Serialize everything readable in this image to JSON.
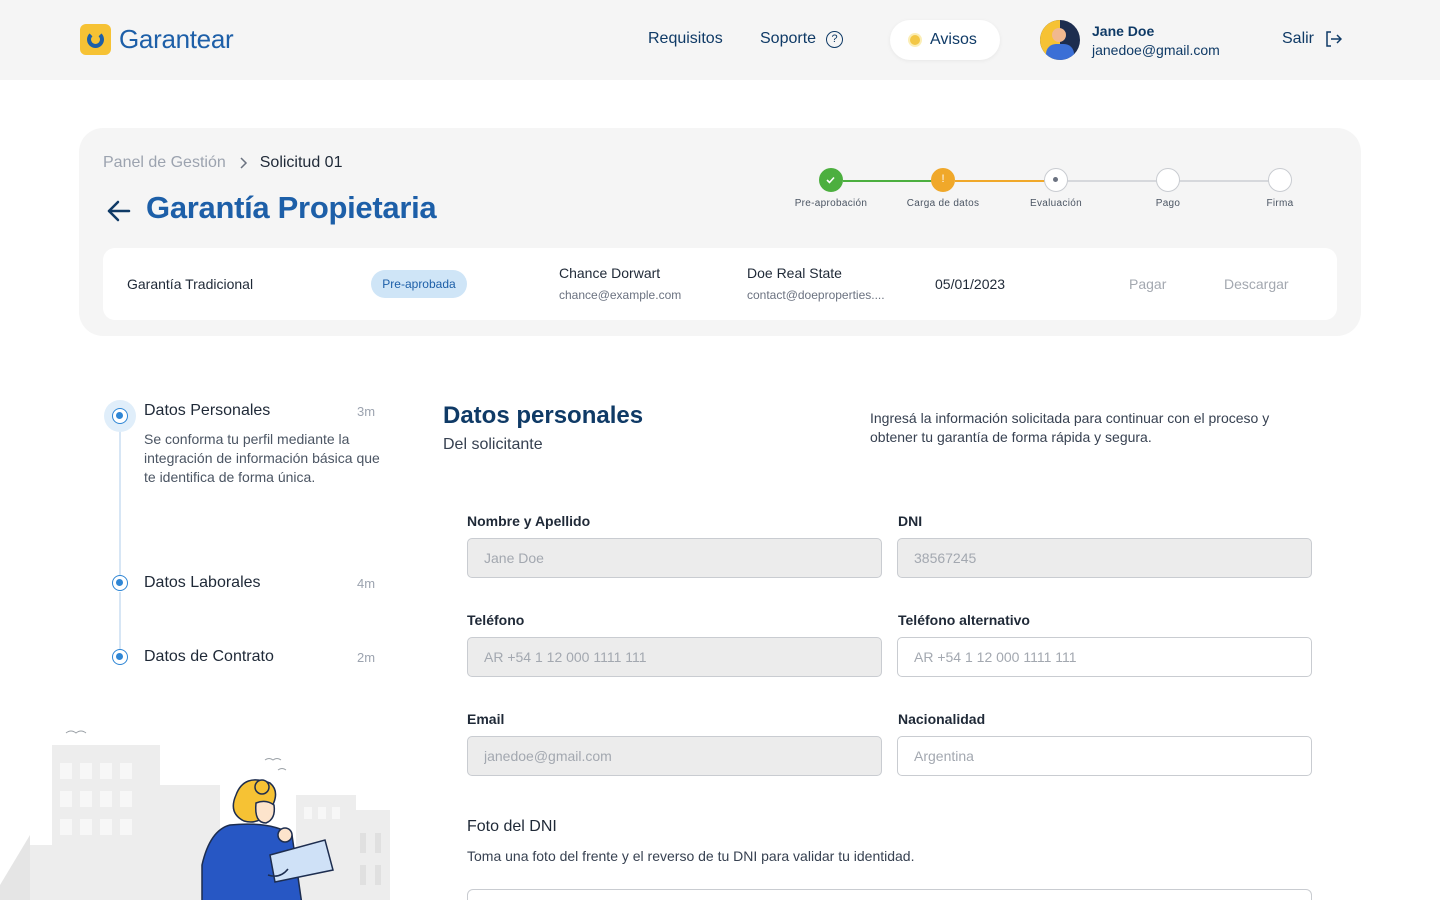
{
  "header": {
    "brand": "Garantear",
    "nav": {
      "requisitos": "Requisitos",
      "soporte": "Soporte",
      "avisos": "Avisos",
      "salir": "Salir"
    },
    "user": {
      "name": "Jane Doe",
      "email": "janedoe@gmail.com"
    }
  },
  "request": {
    "breadcrumb": [
      "Panel de Gestión",
      "Solicitud 01"
    ],
    "title": "Garantía Propietaria",
    "steps": [
      {
        "label": "Pre-aprobación",
        "status": "done",
        "mark": "✓"
      },
      {
        "label": "Carga de datos",
        "status": "warning",
        "mark": "!"
      },
      {
        "label": "Evaluación",
        "status": "current",
        "mark": ""
      },
      {
        "label": "Pago",
        "status": "pending",
        "mark": ""
      },
      {
        "label": "Firma",
        "status": "pending",
        "mark": ""
      }
    ],
    "summary": {
      "type": "Garantía Tradicional",
      "badge": "Pre-aprobada",
      "tenant_name": "Chance Dorwart",
      "tenant_email": "chance@example.com",
      "agency_name": "Doe Real State",
      "agency_email": "contact@doeproperties....",
      "date": "05/01/2023",
      "pay": "Pagar",
      "download": "Descargar"
    }
  },
  "timeline": [
    {
      "title": "Datos Personales",
      "time": "3m",
      "description": "Se conforma tu perfil mediante la integración de información básica que te identifica de forma única."
    },
    {
      "title": "Datos Laborales",
      "time": "4m"
    },
    {
      "title": "Datos de Contrato",
      "time": "2m"
    }
  ],
  "form": {
    "title": "Datos personales",
    "subtitle": "Del solicitante",
    "intro": "Ingresá la información solicitada para continuar con el proceso y obtener tu garantía de forma rápida y segura.",
    "fields": {
      "name": {
        "label": "Nombre y Apellido",
        "placeholder": "Jane Doe"
      },
      "dni": {
        "label": "DNI",
        "placeholder": "38567245"
      },
      "phone": {
        "label": "Teléfono",
        "placeholder": "AR +54 1 12 000 1111 111"
      },
      "alt_phone": {
        "label": "Teléfono alternativo",
        "placeholder": "AR +54 1 12 000 1111 111"
      },
      "email": {
        "label": "Email",
        "placeholder": "janedoe@gmail.com"
      },
      "nationality": {
        "label": "Nacionalidad",
        "placeholder": "Argentina"
      }
    },
    "dni_photo": {
      "title": "Foto del DNI",
      "description": "Toma una foto del frente y el reverso de tu DNI para validar tu identidad."
    }
  },
  "colors": {
    "brand_blue": "#1d5fa8",
    "navy": "#0f3a66",
    "brand_yellow": "#f6c234",
    "success": "#4caf3f",
    "warning": "#f0a82a",
    "timeline_blue": "#2f86d5"
  },
  "icons": {
    "logo": "smile-logo-icon",
    "soporte": "question-icon",
    "avisos": "notification-dot-icon",
    "salir": "logout-icon",
    "back": "arrow-left-icon",
    "breadcrumb": "chevron-right-icon"
  }
}
